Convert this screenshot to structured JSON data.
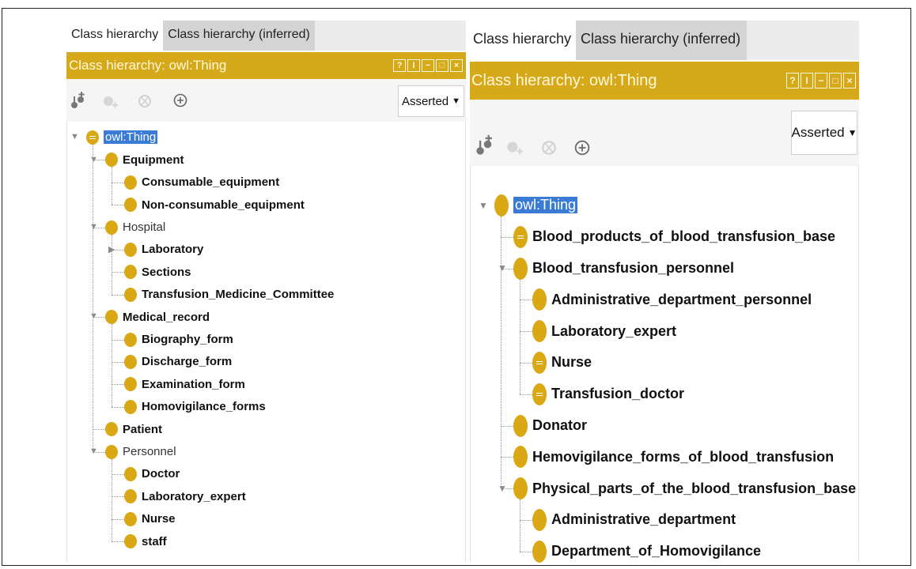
{
  "panels": [
    {
      "tabs": [
        "Class hierarchy",
        "Class hierarchy (inferred)"
      ],
      "header_title": "Class hierarchy: owl:Thing",
      "window_buttons": [
        "?",
        "I",
        "−",
        "□",
        "×"
      ],
      "dropdown_value": "Asserted",
      "tree": [
        {
          "label": "owl:Thing",
          "expanded": true,
          "defined": true,
          "root": true
        },
        {
          "label": "Equipment",
          "expanded": true
        },
        {
          "label": "Consumable_equipment"
        },
        {
          "label": "Non-consumable_equipment"
        },
        {
          "label": "Hospital",
          "expanded": true,
          "plain": true
        },
        {
          "label": "Laboratory",
          "collapsed": true
        },
        {
          "label": "Sections"
        },
        {
          "label": "Transfusion_Medicine_Committee"
        },
        {
          "label": "Medical_record",
          "expanded": true
        },
        {
          "label": "Biography_form"
        },
        {
          "label": "Discharge_form"
        },
        {
          "label": "Examination_form"
        },
        {
          "label": "Homovigilance_forms"
        },
        {
          "label": "Patient"
        },
        {
          "label": "Personnel",
          "expanded": true,
          "plain": true
        },
        {
          "label": "Doctor"
        },
        {
          "label": "Laboratory_expert"
        },
        {
          "label": "Nurse"
        },
        {
          "label": "staff"
        }
      ]
    },
    {
      "tabs": [
        "Class hierarchy",
        "Class hierarchy (inferred)"
      ],
      "header_title": "Class hierarchy: owl:Thing",
      "window_buttons": [
        "?",
        "I",
        "−",
        "□",
        "×"
      ],
      "dropdown_value": "Asserted",
      "tree": [
        {
          "label": "owl:Thing",
          "expanded": true,
          "root": true
        },
        {
          "label": "Blood_products_of_blood_transfusion_base",
          "defined": true
        },
        {
          "label": "Blood_transfusion_personnel",
          "expanded": true
        },
        {
          "label": "Administrative_department_personnel"
        },
        {
          "label": "Laboratory_expert"
        },
        {
          "label": "Nurse",
          "defined": true
        },
        {
          "label": "Transfusion_doctor",
          "defined": true
        },
        {
          "label": "Donator"
        },
        {
          "label": "Hemovigilance_forms_of_blood_transfusion"
        },
        {
          "label": "Physical_parts_of_the_blood_transfusion_base",
          "expanded": true
        },
        {
          "label": "Administrative_department"
        },
        {
          "label": "Department_of_Homovigilance"
        }
      ]
    }
  ],
  "colors": {
    "header_bg": "#d6a91b",
    "bullet": "#d9a814",
    "selection": "#3a7bd5"
  },
  "icons": [
    "add-subclass-icon",
    "add-sibling-icon",
    "delete-class-icon",
    "target-icon"
  ]
}
